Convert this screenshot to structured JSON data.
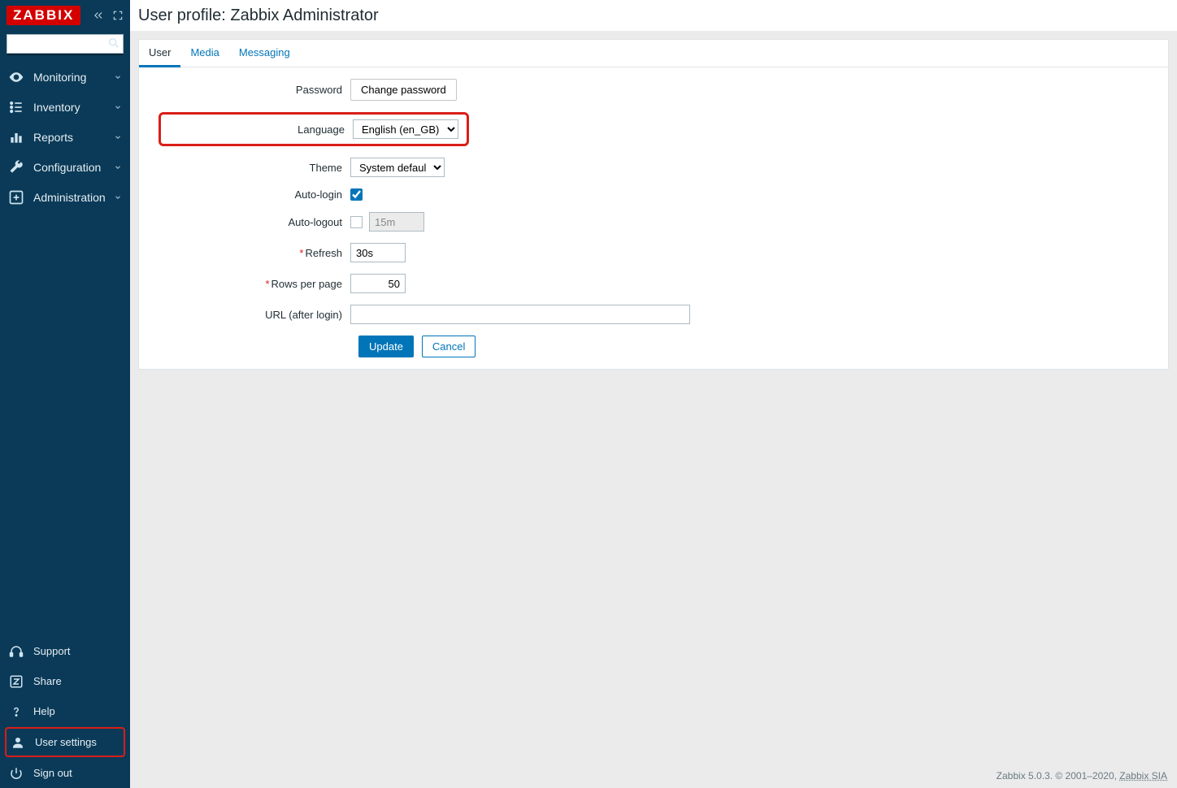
{
  "brand": "ZABBIX",
  "sidebar": {
    "search_placeholder": "",
    "nav": [
      {
        "icon": "eye",
        "label": "Monitoring"
      },
      {
        "icon": "list",
        "label": "Inventory"
      },
      {
        "icon": "bar",
        "label": "Reports"
      },
      {
        "icon": "wrench",
        "label": "Configuration"
      },
      {
        "icon": "gear",
        "label": "Administration"
      }
    ],
    "bottom": [
      {
        "icon": "headset",
        "label": "Support"
      },
      {
        "icon": "z",
        "label": "Share"
      },
      {
        "icon": "qmark",
        "label": "Help"
      },
      {
        "icon": "user",
        "label": "User settings",
        "highlighted": true
      },
      {
        "icon": "power",
        "label": "Sign out"
      }
    ]
  },
  "page": {
    "title": "User profile: Zabbix Administrator"
  },
  "tabs": [
    {
      "label": "User",
      "active": true
    },
    {
      "label": "Media"
    },
    {
      "label": "Messaging"
    }
  ],
  "form": {
    "password_label": "Password",
    "password_button": "Change password",
    "language_label": "Language",
    "language_value": "English (en_GB)",
    "theme_label": "Theme",
    "theme_value": "System default",
    "autologin_label": "Auto-login",
    "autologin_checked": true,
    "autologout_label": "Auto-logout",
    "autologout_checked": false,
    "autologout_value": "15m",
    "refresh_label": "Refresh",
    "refresh_value": "30s",
    "rows_label": "Rows per page",
    "rows_value": "50",
    "url_label": "URL (after login)",
    "url_value": "",
    "update_label": "Update",
    "cancel_label": "Cancel"
  },
  "footer": {
    "text": "Zabbix 5.0.3. © 2001–2020, ",
    "link": "Zabbix SIA"
  }
}
